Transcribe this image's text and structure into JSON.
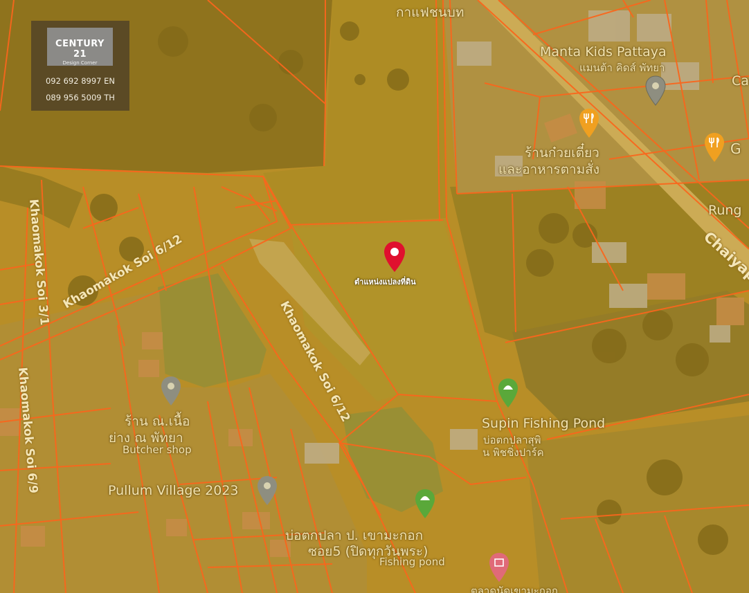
{
  "brand": {
    "name": "CENTURY 21",
    "subtitle": "Design Corner",
    "phone_en": "092 692 8997 EN",
    "phone_th": "089 956 5009 TH"
  },
  "parcel": {
    "caption": "ตำแหน่งแปลงที่ดิน",
    "marker_color": "#e0102e"
  },
  "roads": {
    "soi_6_12_a": "Khaomakok Soi 6/12",
    "soi_6_12_b": "Khaomakok Soi 6/12",
    "soi_3_1": "Khaomakok Soi 3/1",
    "soi_6_9": "Khaomakok Soi 6/9",
    "chaiya": "Chaiyap"
  },
  "places": {
    "kafae": "กาแฟชนบท",
    "manta_en": "Manta Kids Pattaya",
    "manta_th": "แมนต้า คิดส์ พัทยา",
    "ca": "Ca",
    "noodle_th1": "ร้านก๋วยเตี๋ยว",
    "noodle_th2": "และอาหารตามสั่ง",
    "g": "G",
    "rung": "Rung",
    "supin_en": "Supin Fishing Pond",
    "supin_th1": "บ่อตกปลาสุพิ",
    "supin_th2": "น พิชชิ่งปาร์ค",
    "butcher_th1": "ร้าน ณ.เนื้อ",
    "butcher_th2": "ย่าง ณ พัทยา",
    "butcher_en": "Butcher shop",
    "pullum": "Pullum Village 2023",
    "pond_th1": "บ่อตกปลา ป. เขามะกอก",
    "pond_th2": "ซอย5 (ปิดทุกวันพระ)",
    "pond_en": "Fishing pond",
    "bottom": "ตลาดนัดเขามะกอก"
  },
  "colors": {
    "parcel_lines": "#ff5a1e",
    "tint": "#c49a2a",
    "label": "#f2e3b0"
  }
}
